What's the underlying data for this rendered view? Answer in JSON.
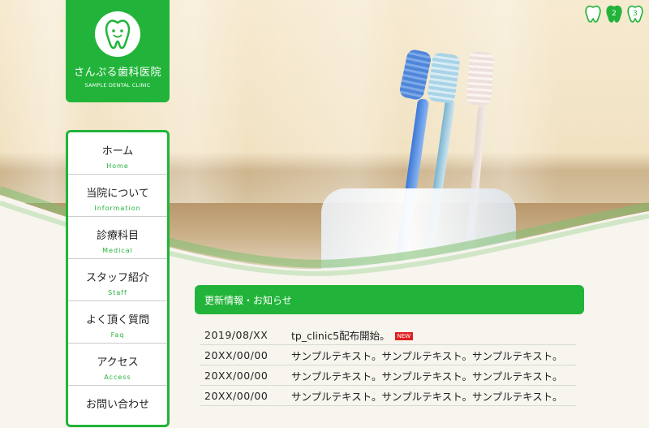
{
  "logo": {
    "name": "さんぷる歯科医院",
    "sub": "SAMPLE DENTAL CLINIC",
    "icon": "tooth-icon",
    "color": "#22b43a"
  },
  "nav": {
    "items": [
      {
        "ja": "ホーム",
        "en": "Home"
      },
      {
        "ja": "当院について",
        "en": "Information"
      },
      {
        "ja": "診療科目",
        "en": "Medical"
      },
      {
        "ja": "スタッフ紹介",
        "en": "Staff"
      },
      {
        "ja": "よく頂く質問",
        "en": "Faq"
      },
      {
        "ja": "アクセス",
        "en": "Access"
      },
      {
        "ja": "お問い合わせ",
        "en": ""
      }
    ]
  },
  "slider": {
    "indicators": [
      {
        "label": "",
        "active": false
      },
      {
        "label": "2",
        "active": true
      },
      {
        "label": "3",
        "active": false
      }
    ]
  },
  "news": {
    "title": "更新情報・お知らせ",
    "badge": "NEW",
    "rows": [
      {
        "date": "2019/08/XX",
        "text": "tp_clinic5配布開始。"
      },
      {
        "date": "20XX/00/00",
        "text": "サンプルテキスト。サンプルテキスト。サンプルテキスト。"
      },
      {
        "date": "20XX/00/00",
        "text": "サンプルテキスト。サンプルテキスト。サンプルテキスト。"
      },
      {
        "date": "20XX/00/00",
        "text": "サンプルテキスト。サンプルテキスト。サンプルテキスト。"
      }
    ]
  }
}
